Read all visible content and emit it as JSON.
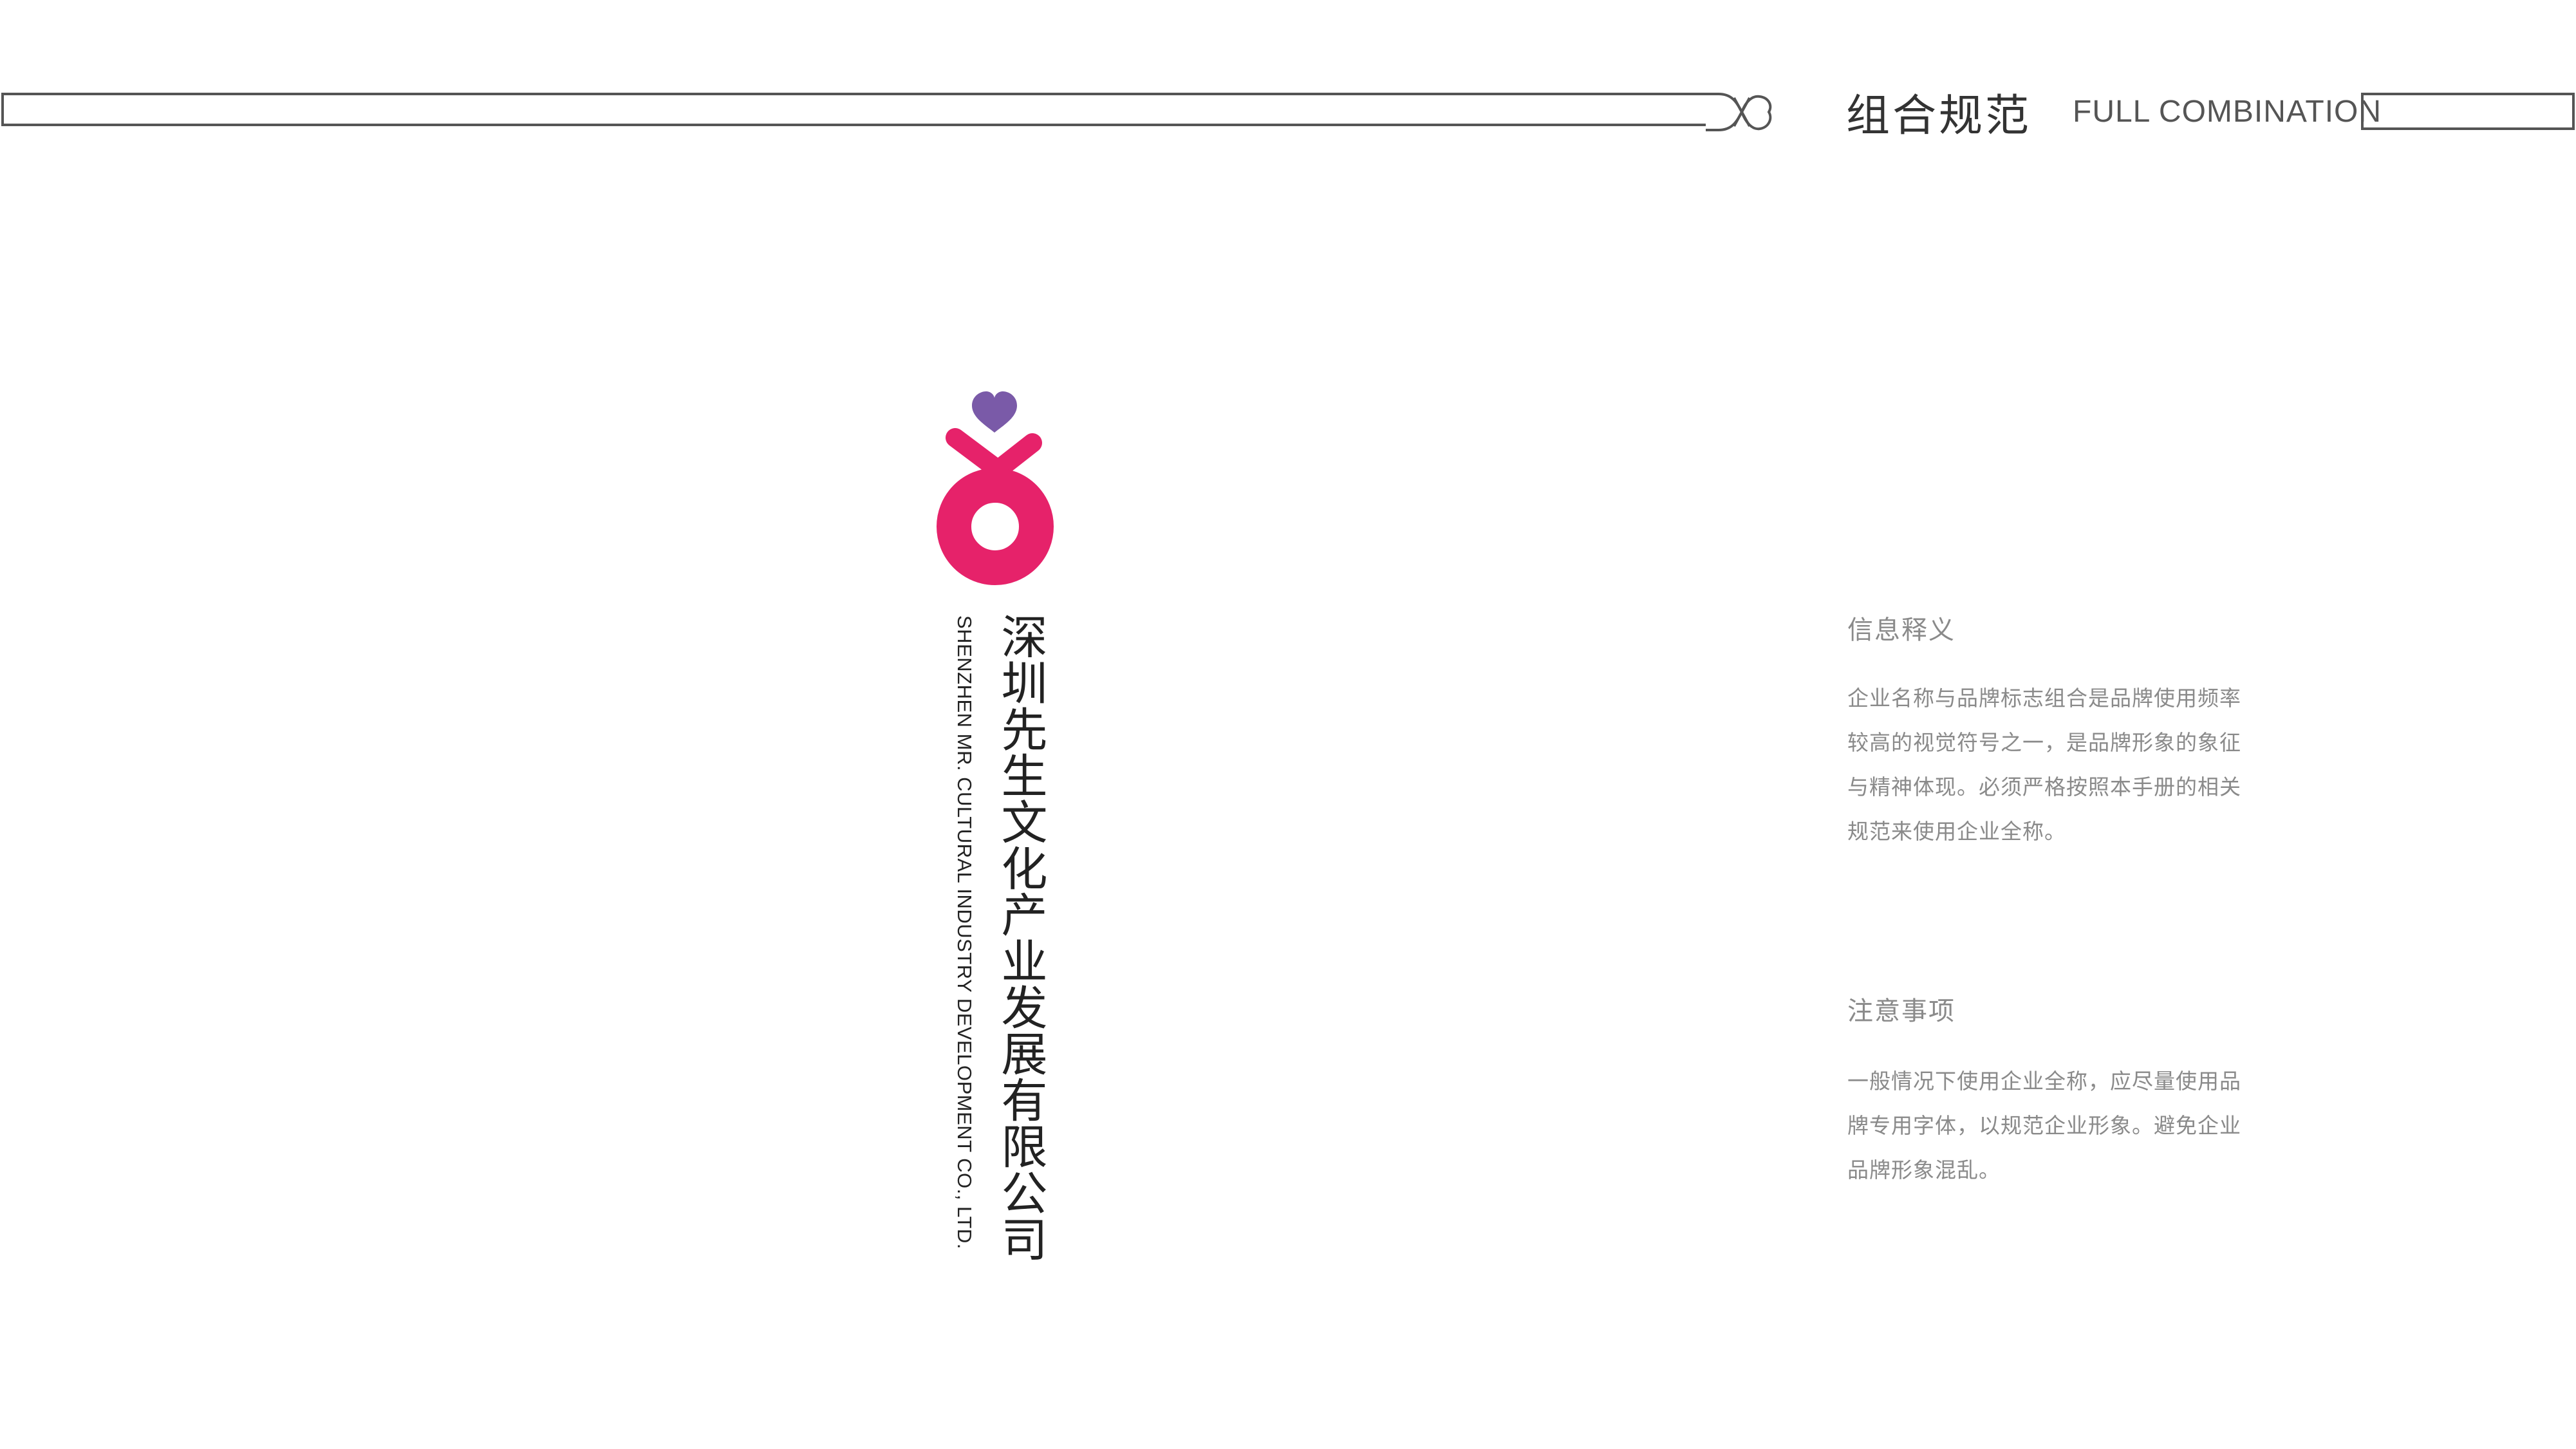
{
  "header": {
    "title": "组合规范",
    "subtitle": "FULL COMBINATION"
  },
  "logo": {
    "company_name_cn": "深圳先生文化产业发展有限公司",
    "company_name_en": "SHENZHEN MR. CULTURAL INDUSTRY DEVELOPMENT CO., LTD.",
    "colors": {
      "heart": "#7a5aa8",
      "mark": "#e6226a"
    }
  },
  "info": {
    "heading": "信息释义",
    "body": "企业名称与品牌标志组合是品牌使用频率较高的视觉符号之一，是品牌形象的象征与精神体现。必须严格按照本手册的相关规范来使用企业全称。"
  },
  "notes": {
    "heading": "注意事项",
    "body": "一般情况下使用企业全称，应尽量使用品牌专用字体，以规范企业形象。避免企业品牌形象混乱。"
  }
}
